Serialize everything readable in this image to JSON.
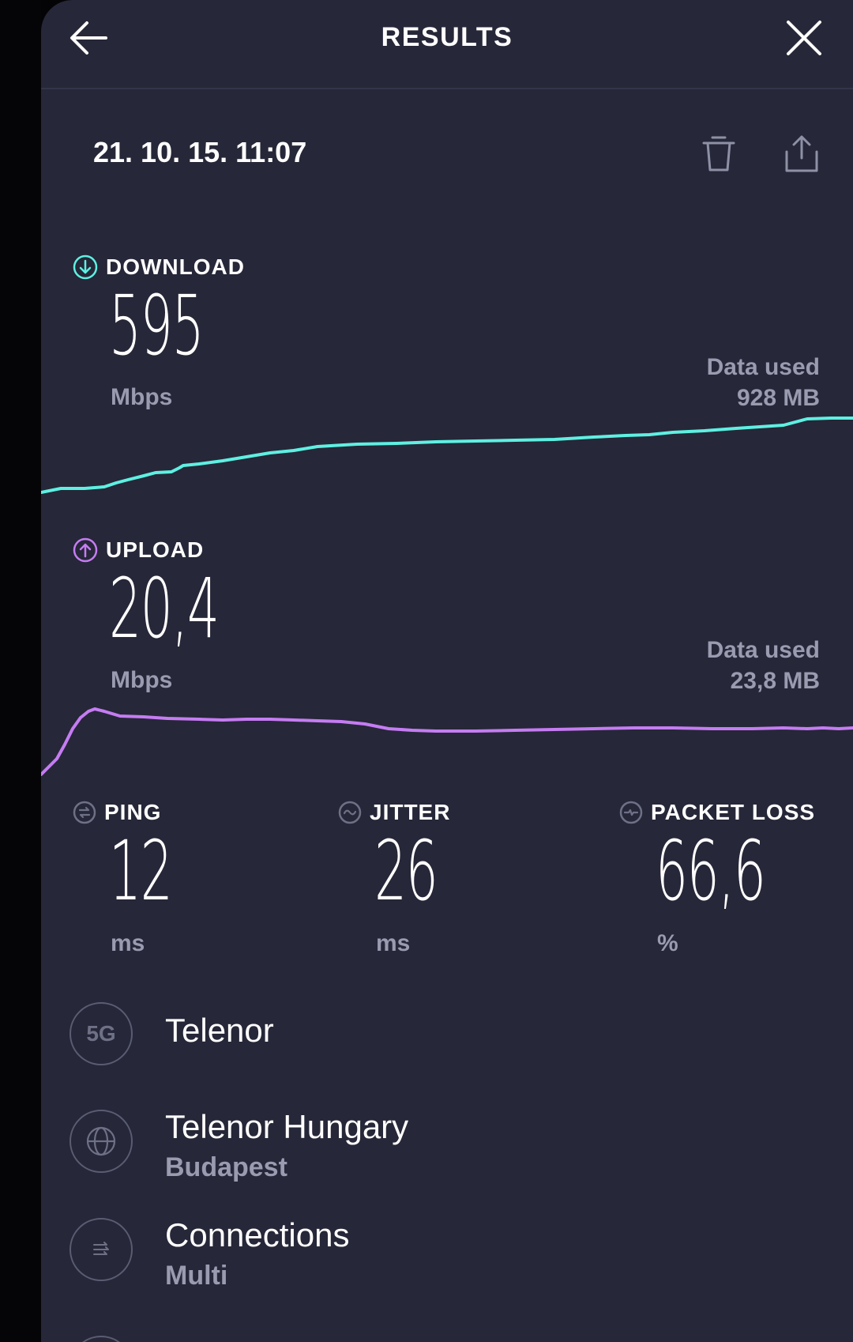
{
  "header": {
    "title": "RESULTS",
    "back_icon": "arrow-left-icon",
    "close_icon": "close-icon"
  },
  "result": {
    "datetime": "21. 10. 15. 11:07",
    "delete_icon": "trash-icon",
    "share_icon": "share-icon"
  },
  "download": {
    "label": "DOWNLOAD",
    "value": "595",
    "unit": "Mbps",
    "data_used_label": "Data used",
    "data_used_value": "928 MB",
    "color": "#5ef0e2"
  },
  "upload": {
    "label": "UPLOAD",
    "value": "20,4",
    "unit": "Mbps",
    "data_used_label": "Data used",
    "data_used_value": "23,8 MB",
    "color": "#c57cf2"
  },
  "ping": {
    "label": "PING",
    "value": "12",
    "unit": "ms"
  },
  "jitter": {
    "label": "JITTER",
    "value": "26",
    "unit": "ms"
  },
  "packet_loss": {
    "label": "PACKET LOSS",
    "value": "66,6",
    "unit": "%"
  },
  "network": {
    "badge": "5G",
    "provider": "Telenor"
  },
  "server": {
    "name": "Telenor Hungary",
    "location": "Budapest"
  },
  "connections": {
    "label": "Connections",
    "value": "Multi"
  }
}
